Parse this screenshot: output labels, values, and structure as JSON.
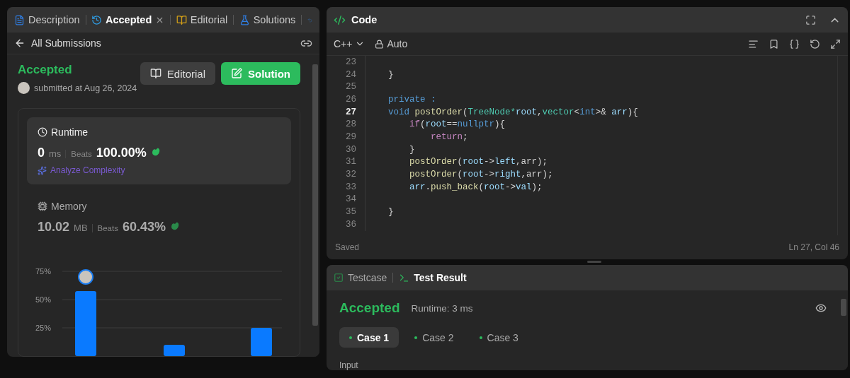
{
  "left_panel": {
    "tabs": [
      {
        "label": "Description",
        "selected": false,
        "closable": false
      },
      {
        "label": "Accepted",
        "selected": true,
        "closable": true
      },
      {
        "label": "Editorial",
        "selected": false,
        "closable": false
      },
      {
        "label": "Solutions",
        "selected": false,
        "closable": false
      }
    ],
    "back_link": "All Submissions",
    "submission": {
      "status": "Accepted",
      "submitted": "submitted at Aug 26, 2024",
      "buttons": [
        {
          "label": "Editorial",
          "kind": "secondary"
        },
        {
          "label": "Solution",
          "kind": "primary"
        }
      ]
    },
    "runtime": {
      "title": "Runtime",
      "value": "0",
      "unit": "ms",
      "beats_label": "Beats",
      "beats": "100.00%",
      "analyze": "Analyze Complexity",
      "selected": true
    },
    "memory": {
      "title": "Memory",
      "value": "10.02",
      "unit": "MB",
      "beats_label": "Beats",
      "beats": "60.43%",
      "selected": false
    },
    "chart_data": {
      "type": "bar",
      "values": [
        57.5,
        10,
        25
      ],
      "ylim": [
        0,
        75
      ],
      "yticks": [
        {
          "value": 25,
          "label": "25%"
        },
        {
          "value": 50,
          "label": "50%"
        },
        {
          "value": 75,
          "label": "75%"
        }
      ]
    }
  },
  "code_panel": {
    "title": "Code",
    "language": "C++",
    "mode": "Auto",
    "lines": [
      {
        "number": "23",
        "current": false
      },
      {
        "number": "24",
        "current": false,
        "tokens": [
          {
            "text": "    }",
            "kind": "plain"
          }
        ]
      },
      {
        "number": "25",
        "current": false
      },
      {
        "number": "26",
        "current": false,
        "tokens": [
          {
            "text": "    private :",
            "kind": "keyword"
          }
        ]
      },
      {
        "number": "27",
        "current": true,
        "tokens": [
          {
            "text": "    void ",
            "kind": "keyword"
          },
          {
            "text": "postOrder",
            "kind": "function"
          },
          {
            "text": "(",
            "kind": "plain"
          },
          {
            "text": "TreeNode*",
            "kind": "type"
          },
          {
            "text": "root",
            "kind": "variable"
          },
          {
            "text": ",",
            "kind": "plain"
          },
          {
            "text": "vector",
            "kind": "type"
          },
          {
            "text": "<",
            "kind": "plain"
          },
          {
            "text": "int",
            "kind": "keyword"
          },
          {
            "text": ">& ",
            "kind": "plain"
          },
          {
            "text": "arr",
            "kind": "variable"
          },
          {
            "text": "){",
            "kind": "plain"
          }
        ]
      },
      {
        "number": "28",
        "current": false,
        "tokens": [
          {
            "text": "        if",
            "kind": "control"
          },
          {
            "text": "(",
            "kind": "plain"
          },
          {
            "text": "root",
            "kind": "variable"
          },
          {
            "text": "==",
            "kind": "plain"
          },
          {
            "text": "nullptr",
            "kind": "keyword"
          },
          {
            "text": "){",
            "kind": "plain"
          }
        ]
      },
      {
        "number": "29",
        "current": false,
        "tokens": [
          {
            "text": "            return",
            "kind": "control"
          },
          {
            "text": ";",
            "kind": "plain"
          }
        ]
      },
      {
        "number": "30",
        "current": false,
        "tokens": [
          {
            "text": "        }",
            "kind": "plain"
          }
        ]
      },
      {
        "number": "31",
        "current": false,
        "tokens": [
          {
            "text": "        postOrder",
            "kind": "function"
          },
          {
            "text": "(",
            "kind": "plain"
          },
          {
            "text": "root",
            "kind": "variable"
          },
          {
            "text": "->",
            "kind": "plain"
          },
          {
            "text": "left",
            "kind": "variable"
          },
          {
            "text": ",arr);",
            "kind": "plain"
          }
        ]
      },
      {
        "number": "32",
        "current": false,
        "tokens": [
          {
            "text": "        postOrder",
            "kind": "function"
          },
          {
            "text": "(",
            "kind": "plain"
          },
          {
            "text": "root",
            "kind": "variable"
          },
          {
            "text": "->",
            "kind": "plain"
          },
          {
            "text": "right",
            "kind": "variable"
          },
          {
            "text": ",arr);",
            "kind": "plain"
          }
        ]
      },
      {
        "number": "33",
        "current": false,
        "tokens": [
          {
            "text": "        arr",
            "kind": "variable"
          },
          {
            "text": ".",
            "kind": "plain"
          },
          {
            "text": "push_back",
            "kind": "function"
          },
          {
            "text": "(",
            "kind": "plain"
          },
          {
            "text": "root",
            "kind": "variable"
          },
          {
            "text": "->",
            "kind": "plain"
          },
          {
            "text": "val",
            "kind": "variable"
          },
          {
            "text": ");",
            "kind": "plain"
          }
        ]
      },
      {
        "number": "34",
        "current": false
      },
      {
        "number": "35",
        "current": false,
        "tokens": [
          {
            "text": "    }",
            "kind": "plain"
          }
        ]
      },
      {
        "number": "36",
        "current": false
      }
    ],
    "status": "Saved",
    "cursor": "Ln 27, Col 46"
  },
  "test_panel": {
    "tabs": [
      {
        "label": "Testcase",
        "selected": false
      },
      {
        "label": "Test Result",
        "selected": true
      }
    ],
    "result": "Accepted",
    "runtime": "Runtime: 3 ms",
    "cases": [
      {
        "label": "Case 1",
        "selected": true
      },
      {
        "label": "Case 2",
        "selected": false
      },
      {
        "label": "Case 3",
        "selected": false
      }
    ],
    "input_label": "Input"
  }
}
